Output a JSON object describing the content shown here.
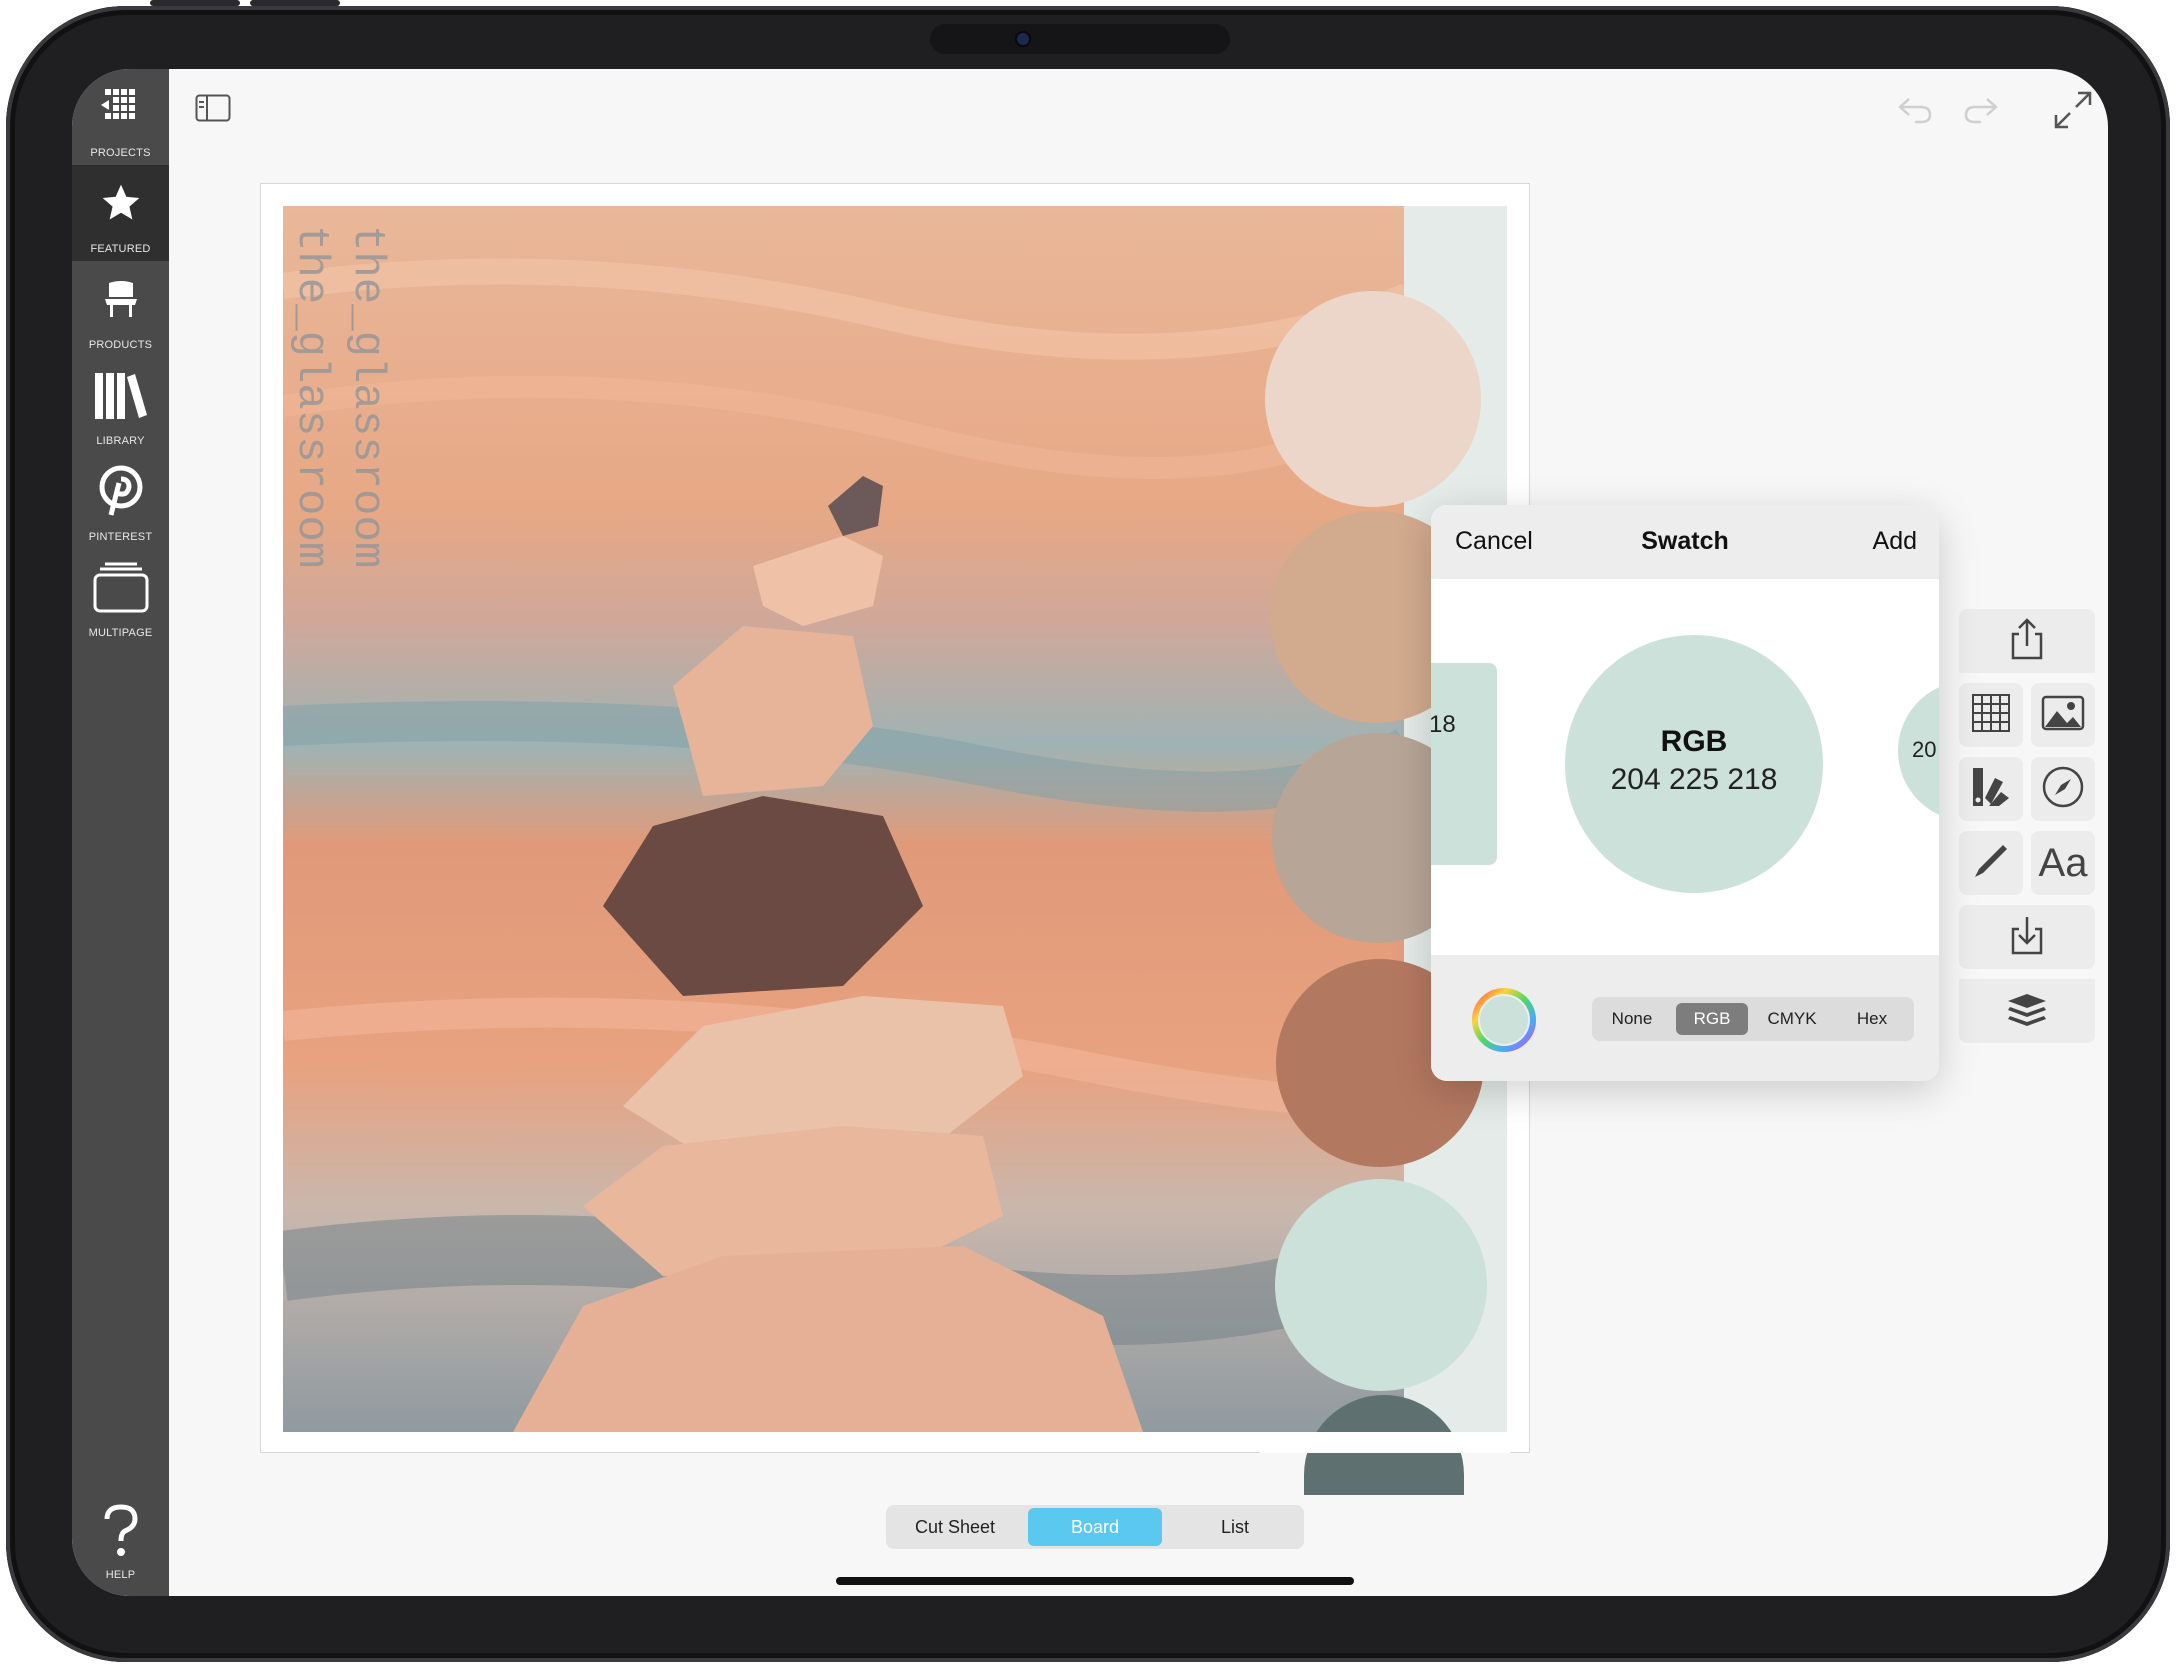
{
  "app": {
    "colors": {
      "sidebar": "#4a4a4a",
      "sidebar_active": "#2f2f2f",
      "accent": "#5bc8f0",
      "swatch_current": "#cce1da"
    }
  },
  "sidebar": {
    "items": [
      {
        "label": "PROJECTS",
        "icon": "grid-icon"
      },
      {
        "label": "FEATURED",
        "icon": "star-icon"
      },
      {
        "label": "PRODUCTS",
        "icon": "chair-icon"
      },
      {
        "label": "LIBRARY",
        "icon": "books-icon"
      },
      {
        "label": "PINTEREST",
        "icon": "pinterest-icon"
      },
      {
        "label": "MULTIPAGE",
        "icon": "pages-icon"
      }
    ],
    "help": {
      "label": "HELP",
      "icon": "help-icon"
    }
  },
  "toolbar": {
    "icons": [
      "sidebar-toggle-icon",
      "undo-icon",
      "redo-icon",
      "fullscreen-icon"
    ]
  },
  "board": {
    "watermark_1": "the_glassroom",
    "watermark_2": "the_glassroom",
    "palette": [
      "#ecd6c9",
      "#d2aa8e",
      "#b7a597",
      "#b37860",
      "#cce1da",
      "#5e7070"
    ]
  },
  "swatch_popover": {
    "cancel": "Cancel",
    "title": "Swatch",
    "add": "Add",
    "current_model": "RGB",
    "current_value": "204 225 218",
    "prev_partial": "18",
    "next_partial": "20",
    "modes": [
      "None",
      "RGB",
      "CMYK",
      "Hex"
    ],
    "selected_mode": "RGB"
  },
  "right_tools": [
    "share-icon",
    "grid-table-icon",
    "image-icon",
    "swatch-icon",
    "compass-icon",
    "pen-icon",
    "text-icon",
    "download-icon",
    "layers-icon"
  ],
  "text_tool_label": "Aa",
  "view_switcher": {
    "options": [
      "Cut Sheet",
      "Board",
      "List"
    ],
    "selected": "Board"
  }
}
